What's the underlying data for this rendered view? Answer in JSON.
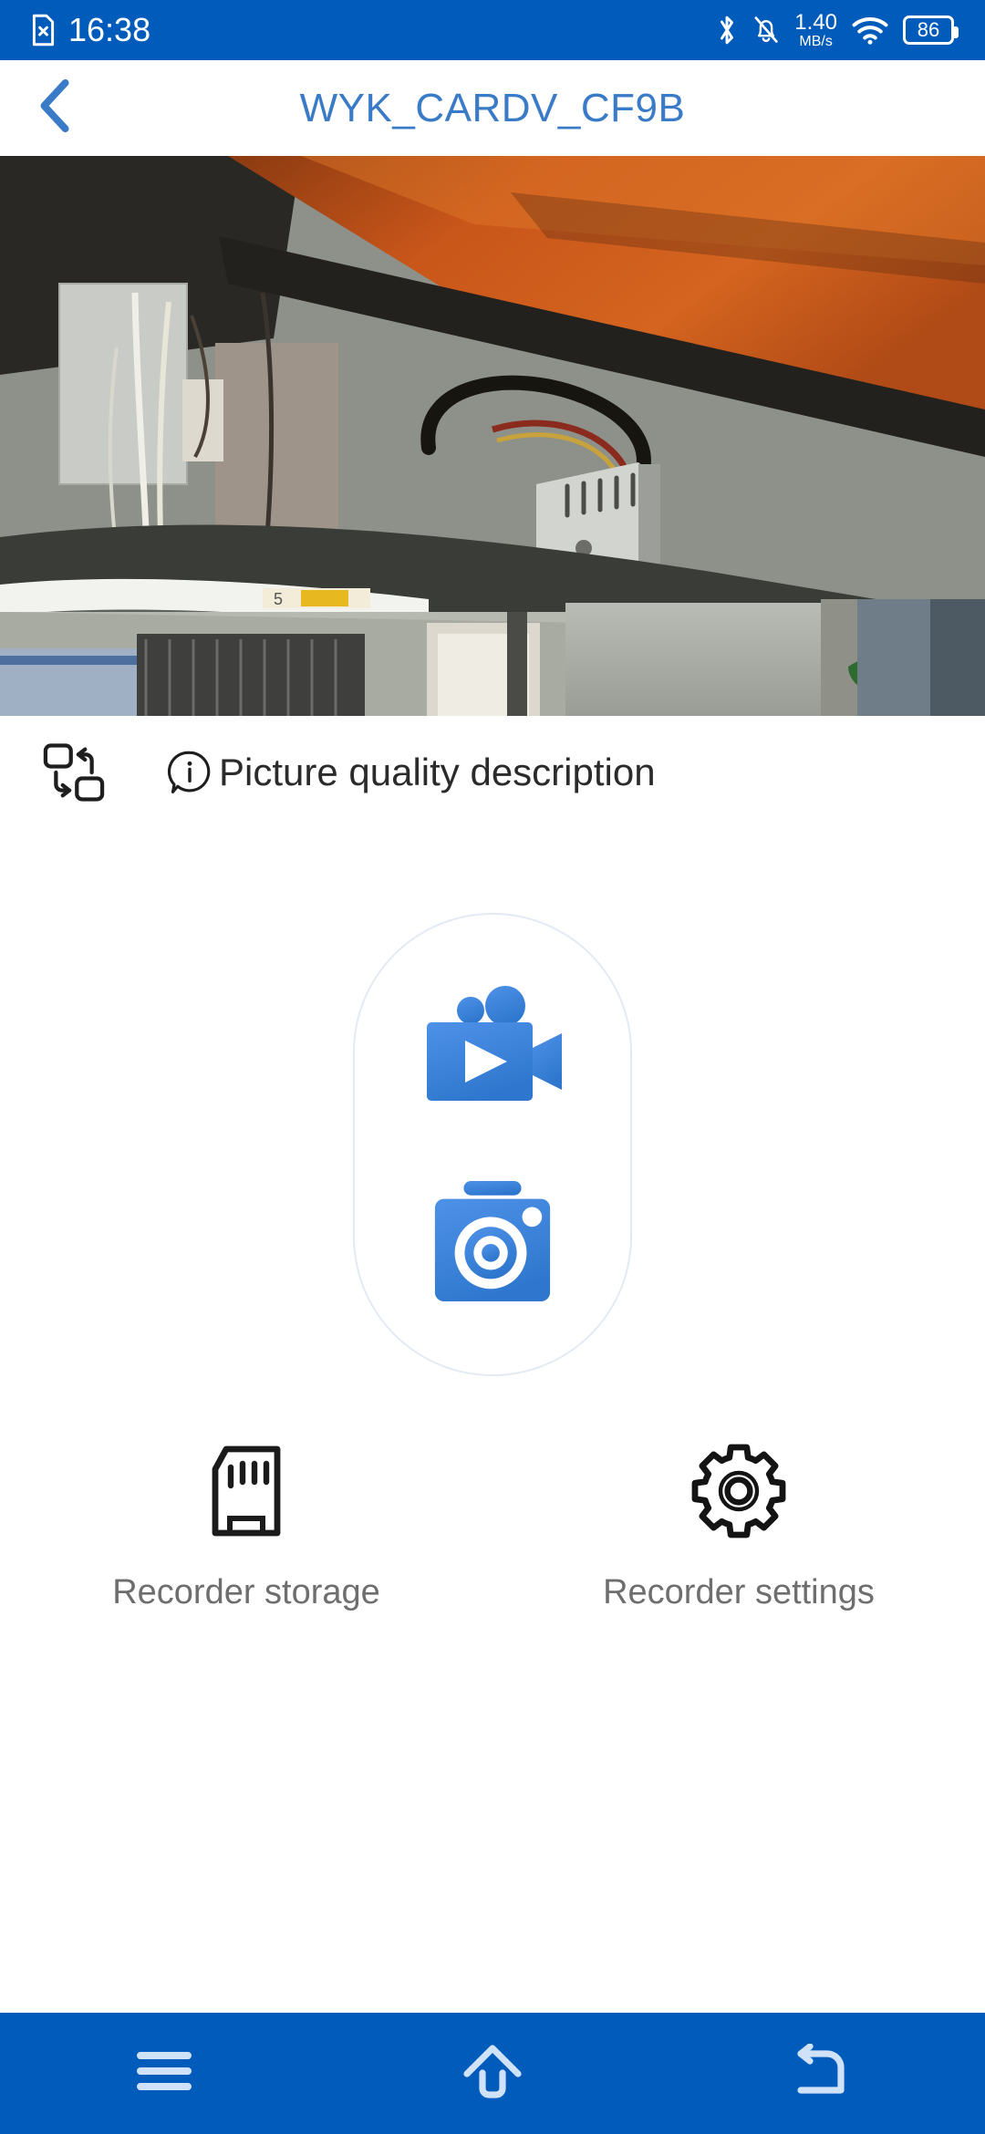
{
  "status_bar": {
    "time": "16:38",
    "sim_icon": "sim-card-off-icon",
    "bluetooth_icon": "bluetooth-icon",
    "mute_icon": "notifications-muted-icon",
    "network_speed_value": "1.40",
    "network_speed_unit": "MB/s",
    "wifi_icon": "wifi-icon",
    "battery_level": "86",
    "background_color": "#005BBB",
    "foreground_color": "#FFFFFF"
  },
  "header": {
    "back_icon": "back-chevron-icon",
    "title": "WYK_CARDV_CF9B",
    "title_color": "#3A7BC8"
  },
  "preview": {
    "name": "live-video-preview",
    "description": "Live dashcam feed showing underside of a wooden desk with cables and equipment"
  },
  "quality_row": {
    "switch_view_icon": "switch-view-icon",
    "info_icon": "info-bubble-icon",
    "description_label": "Picture quality description"
  },
  "modes": {
    "video": {
      "icon": "video-camera-icon",
      "color": "#3E87E0"
    },
    "photo": {
      "icon": "photo-camera-icon",
      "color": "#3E87E0"
    }
  },
  "actions": [
    {
      "icon": "sd-card-icon",
      "label": "Recorder storage"
    },
    {
      "icon": "gear-icon",
      "label": "Recorder settings"
    }
  ],
  "nav_bar": {
    "recents_icon": "recents-menu-icon",
    "home_icon": "home-icon",
    "back_icon": "back-arrow-icon",
    "background_color": "#005BBB",
    "icon_color": "#CFE2F7"
  }
}
